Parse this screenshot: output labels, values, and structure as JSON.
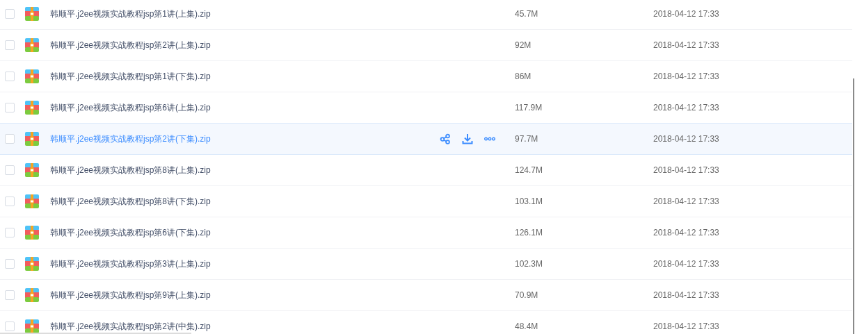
{
  "files": [
    {
      "name": "韩顺平.j2ee视频实战教程jsp第1讲(上集).zip",
      "size": "45.7M",
      "modified": "2018-04-12 17:33",
      "checked": false,
      "hovered": false
    },
    {
      "name": "韩顺平.j2ee视频实战教程jsp第2讲(上集).zip",
      "size": "92M",
      "modified": "2018-04-12 17:33",
      "checked": false,
      "hovered": false
    },
    {
      "name": "韩顺平.j2ee视频实战教程jsp第1讲(下集).zip",
      "size": "86M",
      "modified": "2018-04-12 17:33",
      "checked": false,
      "hovered": false
    },
    {
      "name": "韩顺平.j2ee视频实战教程jsp第6讲(上集).zip",
      "size": "117.9M",
      "modified": "2018-04-12 17:33",
      "checked": false,
      "hovered": false
    },
    {
      "name": "韩顺平.j2ee视频实战教程jsp第2讲(下集).zip",
      "size": "97.7M",
      "modified": "2018-04-12 17:33",
      "checked": false,
      "hovered": true
    },
    {
      "name": "韩顺平.j2ee视频实战教程jsp第8讲(上集).zip",
      "size": "124.7M",
      "modified": "2018-04-12 17:33",
      "checked": false,
      "hovered": false
    },
    {
      "name": "韩顺平.j2ee视频实战教程jsp第8讲(下集).zip",
      "size": "103.1M",
      "modified": "2018-04-12 17:33",
      "checked": false,
      "hovered": false
    },
    {
      "name": "韩顺平.j2ee视频实战教程jsp第6讲(下集).zip",
      "size": "126.1M",
      "modified": "2018-04-12 17:33",
      "checked": false,
      "hovered": false
    },
    {
      "name": "韩顺平.j2ee视频实战教程jsp第3讲(上集).zip",
      "size": "102.3M",
      "modified": "2018-04-12 17:33",
      "checked": false,
      "hovered": false
    },
    {
      "name": "韩顺平.j2ee视频实战教程jsp第9讲(上集).zip",
      "size": "70.9M",
      "modified": "2018-04-12 17:33",
      "checked": false,
      "hovered": false
    },
    {
      "name": "韩顺平.j2ee视频实战教程jsp第2讲(中集).zip",
      "size": "48.4M",
      "modified": "2018-04-12 17:33",
      "checked": false,
      "hovered": false
    }
  ]
}
